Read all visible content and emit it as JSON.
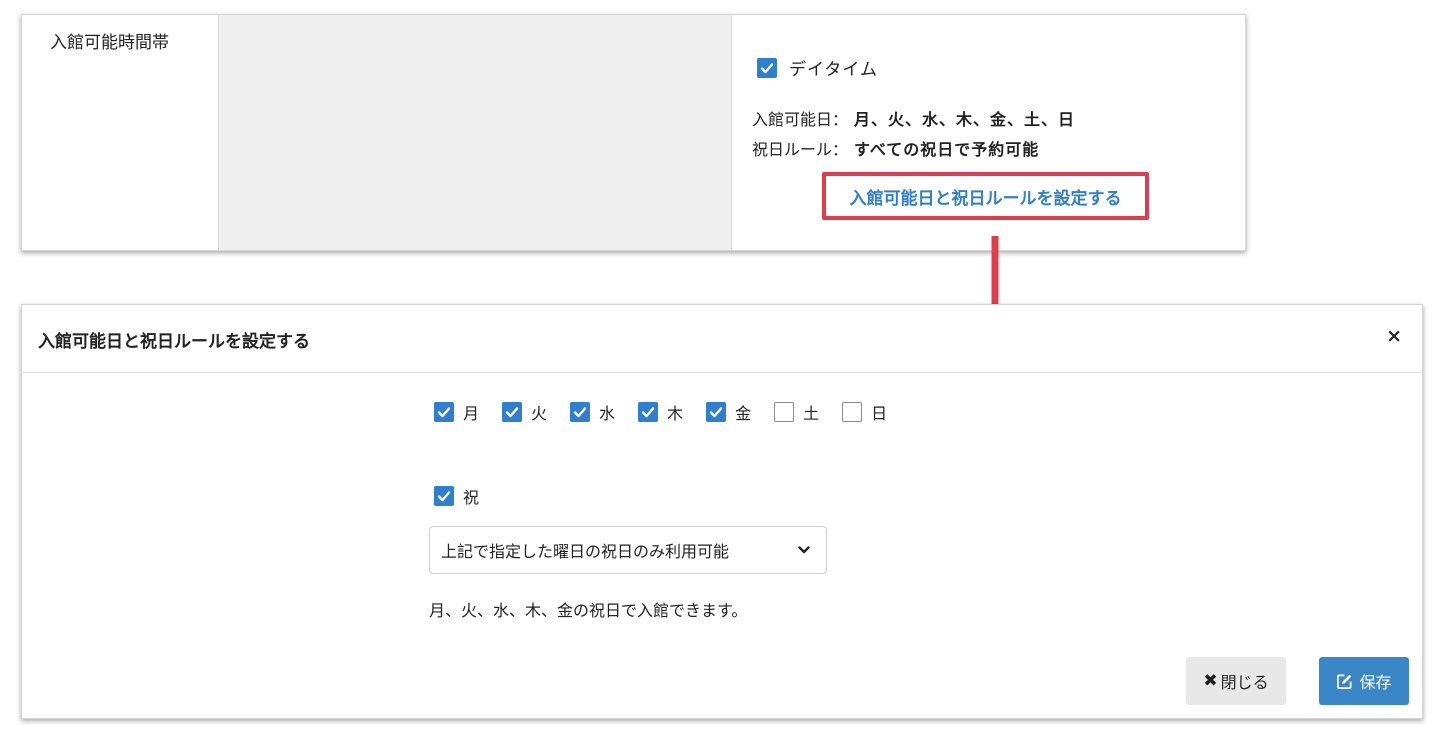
{
  "settings_table": {
    "row_label": "入館可能時間帯",
    "daytime_label": "デイタイム",
    "daytime_checked": true,
    "open_days_label": "入館可能日：",
    "open_days_value": "月、火、水、木、金、土、日",
    "holiday_rule_label": "祝日ルール：",
    "holiday_rule_value": "すべての祝日で予約可能",
    "configure_link": "入館可能日と祝日ルールを設定する"
  },
  "modal": {
    "title": "入館可能日と祝日ルールを設定する",
    "close_glyph": "×",
    "days": [
      {
        "label": "月",
        "checked": true
      },
      {
        "label": "火",
        "checked": true
      },
      {
        "label": "水",
        "checked": true
      },
      {
        "label": "木",
        "checked": true
      },
      {
        "label": "金",
        "checked": true
      },
      {
        "label": "土",
        "checked": false
      },
      {
        "label": "日",
        "checked": false
      }
    ],
    "holiday_label": "祝",
    "holiday_checked": true,
    "holiday_select_value": "上記で指定した曜日の祝日のみ利用可能",
    "description": "月、火、水、木、金の祝日で入館できます。",
    "close_button": "閉じる",
    "save_button": "保存"
  },
  "colors": {
    "accent_blue": "#2e7fce",
    "highlight_red": "#e03c4b",
    "save_blue": "#3a87c8"
  }
}
